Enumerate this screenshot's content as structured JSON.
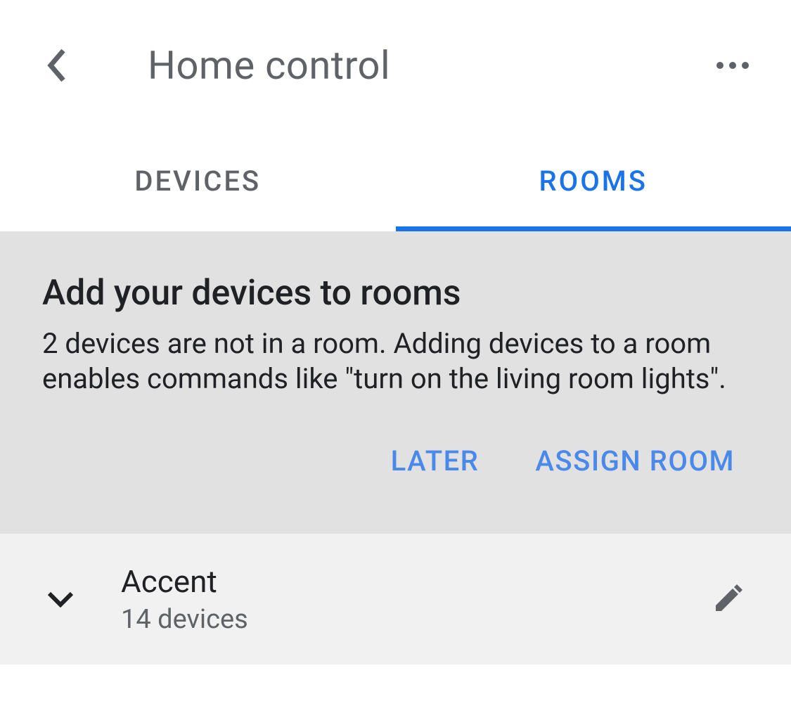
{
  "header": {
    "title": "Home control"
  },
  "tabs": {
    "devices": "DEVICES",
    "rooms": "ROOMS"
  },
  "prompt": {
    "title": "Add your devices to rooms",
    "body": "2 devices are not in a room. Adding devices to a room enables commands like \"turn on the living room lights\".",
    "later": "LATER",
    "assign": "ASSIGN ROOM"
  },
  "rooms": [
    {
      "name": "Accent",
      "count": "14 devices"
    }
  ],
  "colors": {
    "accent": "#1a73e8",
    "text_primary": "#202124",
    "text_secondary": "#5f6368"
  }
}
